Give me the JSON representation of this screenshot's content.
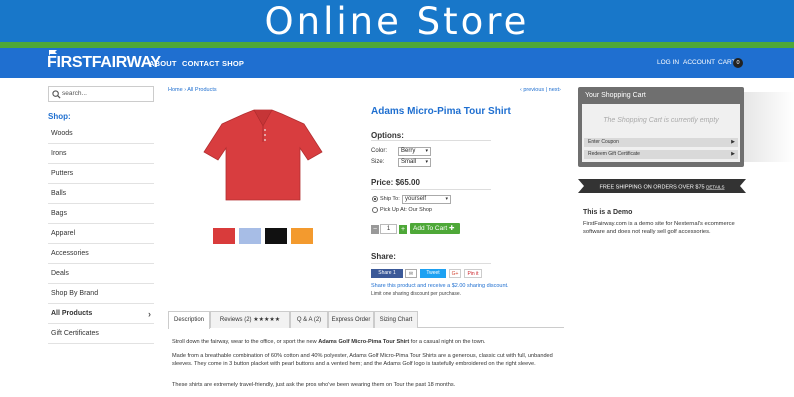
{
  "banner": {
    "title": "Online Store"
  },
  "nav": {
    "logo": "FIRSTFAIRWAY",
    "links": [
      "ABOUT",
      "CONTACT",
      "SHOP"
    ],
    "login": "LOG IN",
    "account": "ACCOUNT",
    "cart": "CART",
    "cart_count": "0"
  },
  "sidebar": {
    "search_placeholder": "search...",
    "shop_title": "Shop:",
    "items": [
      "Woods",
      "Irons",
      "Putters",
      "Balls",
      "Bags",
      "Apparel",
      "Accessories",
      "Deals",
      "Shop By Brand",
      "All Products",
      "Gift Certificates"
    ]
  },
  "breadcrumb": "Home › All Products",
  "pager": "‹ previous  |  next›",
  "product": {
    "title": "Adams Micro-Pima Tour Shirt",
    "options_title": "Options:",
    "color_label": "Color:",
    "color_value": "Berry",
    "size_label": "Size:",
    "size_value": "Small",
    "price": "Price: $65.00",
    "ship_to_label": "Ship To:",
    "ship_to_value": "yourself",
    "pickup_label": "Pick Up At: Our Shop",
    "qty": "1",
    "add_to_cart": "Add To Cart",
    "swatch_colors": [
      "#d93b3b",
      "#a7bde6",
      "#111111",
      "#f39a2e"
    ],
    "shirt_color": "#d83d3f"
  },
  "share": {
    "title": "Share:",
    "facebook": "Share 1",
    "twitter": "Tweet",
    "gplus": "G+",
    "pinterest": "Pin it",
    "promo": "Share this product and receive a $2.00 sharing discount.",
    "note": "Limit one sharing discount per purchase."
  },
  "tabs": [
    "Description",
    "Reviews (2) ★★★★★",
    "Q & A (2)",
    "Express Order",
    "Sizing Chart"
  ],
  "description": {
    "p1_pre": "Stroll down the fairway, wear to the office, or sport the new ",
    "p1_bold": "Adams Golf Micro-Pima Tour Shirt",
    "p1_post": " for a casual night on the town.",
    "p2": "Made from a breathable combination of 60% cotton and 40% polyester, Adams Golf Micro-Pima Tour Shirts are a generous, classic cut with full, unbanded sleeves. They come in 3 button placket with pearl buttons and a vented hem; and the Adams Golf logo is tastefully embroidered on the right sleeve.",
    "p3": "These shirts are extremely travel-friendly, just ask the pros who've been wearing them on Tour the past 18 months."
  },
  "cart_widget": {
    "title": "Your Shopping Cart",
    "empty": "The Shopping Cart is currently empty",
    "coupon": "Enter Coupon",
    "gift": "Redeem Gift Certificate"
  },
  "shipping": {
    "text": "FREE SHIPPING ON ORDERS OVER $75",
    "details": "DETAILS"
  },
  "demo": {
    "title": "This is a Demo",
    "text": "FirstFairway.com is a demo site for Nexternal's ecommerce software and does not really sell golf accessories."
  },
  "colors": {
    "brand_blue": "#1f6fd0",
    "banner_blue": "#1877c9",
    "green": "#4ea838"
  }
}
